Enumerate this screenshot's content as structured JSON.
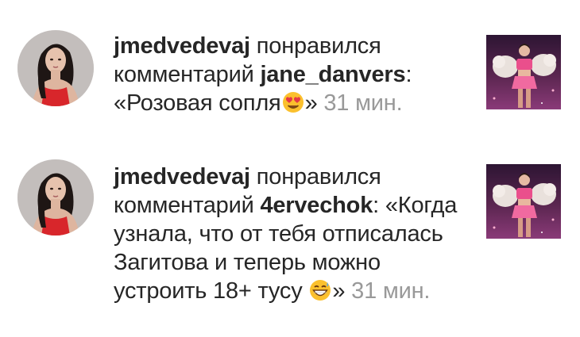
{
  "notifications": [
    {
      "username": "jmedvedevaj",
      "action": " понравился комментарий ",
      "comment_author": "jane_danvers",
      "comment_prefix": ": «",
      "comment_text": "Розовая сопля",
      "emoji": "heart-eyes-emoji",
      "comment_suffix": "» ",
      "time": "31 мин."
    },
    {
      "username": "jmedvedevaj",
      "action": " понравился комментарий ",
      "comment_author": "4ervechok",
      "comment_prefix": ": «",
      "comment_text": "Когда узнала, что от тебя отписалась Загитова и теперь можно устроить 18+ тусу ",
      "emoji": "grinning-sweat-emoji",
      "comment_suffix": "» ",
      "time": "31 мин."
    }
  ],
  "colors": {
    "text": "#262626",
    "timestamp": "#999999",
    "background": "#ffffff",
    "thumbnail_bg": "#5a2a4a",
    "costume_pink": "#e8508a"
  }
}
